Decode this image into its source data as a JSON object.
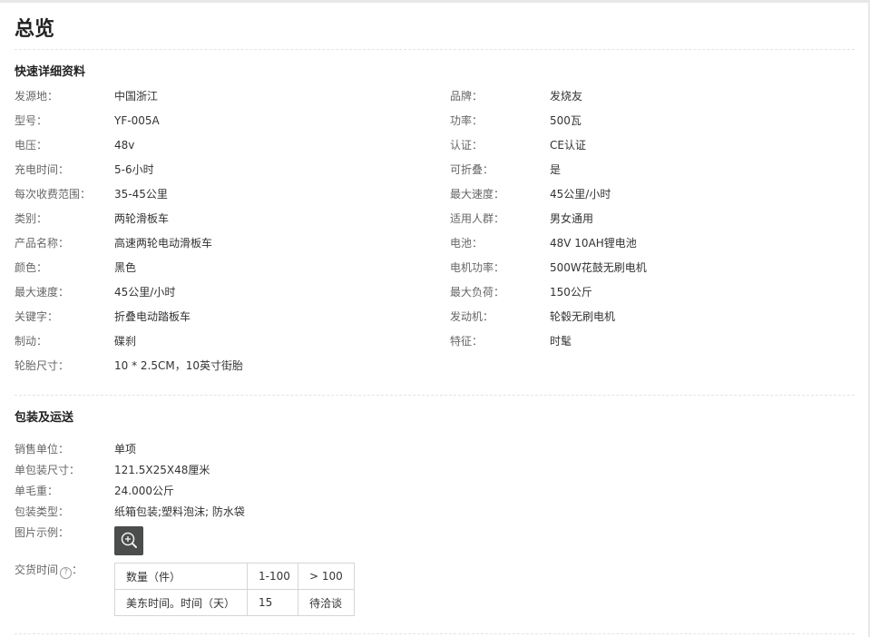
{
  "overview": {
    "title": "总览"
  },
  "quick_details": {
    "title": "快速详细资料",
    "left": [
      {
        "label": "发源地：",
        "value": "中国浙江"
      },
      {
        "label": "型号：",
        "value": "YF-005A"
      },
      {
        "label": "电压：",
        "value": "48v"
      },
      {
        "label": "充电时间：",
        "value": "5-6小时"
      },
      {
        "label": "每次收费范围：",
        "value": "35-45公里"
      },
      {
        "label": "类别：",
        "value": "两轮滑板车"
      },
      {
        "label": "产品名称：",
        "value": "高速两轮电动滑板车"
      },
      {
        "label": "颜色：",
        "value": "黑色"
      },
      {
        "label": "最大速度：",
        "value": "45公里/小时"
      },
      {
        "label": "关键字：",
        "value": "折叠电动踏板车"
      },
      {
        "label": "制动：",
        "value": "碟刹"
      },
      {
        "label": "轮胎尺寸：",
        "value": "10 * 2.5CM，10英寸街胎"
      }
    ],
    "right": [
      {
        "label": "品牌：",
        "value": "发烧友"
      },
      {
        "label": "功率：",
        "value": "500瓦"
      },
      {
        "label": "认证：",
        "value": "CE认证"
      },
      {
        "label": "可折叠：",
        "value": "是"
      },
      {
        "label": "最大速度：",
        "value": "45公里/小时"
      },
      {
        "label": "适用人群：",
        "value": "男女通用"
      },
      {
        "label": "电池：",
        "value": "48V 10AH锂电池"
      },
      {
        "label": "电机功率：",
        "value": "500W花鼓无刷电机"
      },
      {
        "label": "最大负荷：",
        "value": "150公斤"
      },
      {
        "label": "发动机：",
        "value": "轮毂无刷电机"
      },
      {
        "label": "特征：",
        "value": "时髦"
      }
    ]
  },
  "packaging": {
    "title": "包装及运送",
    "rows": [
      {
        "label": "销售单位：",
        "value": "单项"
      },
      {
        "label": "单包装尺寸：",
        "value": "121.5X25X48厘米"
      },
      {
        "label": "单毛重：",
        "value": "24.000公斤"
      },
      {
        "label": "包装类型：",
        "value": "纸箱包装;塑料泡沫; 防水袋"
      },
      {
        "label": "图片示例：",
        "value": ""
      }
    ],
    "image_icon": "zoom-in-icon",
    "lead_time": {
      "label": "交货时间",
      "help_icon": "question-mark-icon",
      "help_glyph": "?",
      "colon": "：",
      "table": [
        [
          "数量（件）",
          "1-100",
          "> 100"
        ],
        [
          "美东时间。时间（天）",
          "15",
          "待洽谈"
        ]
      ]
    }
  },
  "colors": {
    "label": "#666666",
    "value": "#333333",
    "divider": "#e3e3e3",
    "thumb_bg": "#4b4d4d"
  }
}
